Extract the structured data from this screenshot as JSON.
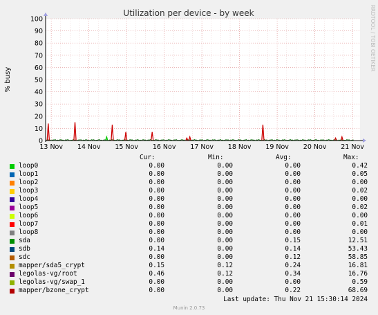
{
  "chart_data": {
    "type": "line",
    "title": "Utilization per device - by week",
    "ylabel": "% busy",
    "side_label": "RRDTOOL / TOBI OETIKER",
    "ylim": [
      0,
      100
    ],
    "yticks": [
      0,
      10,
      20,
      30,
      40,
      50,
      60,
      70,
      80,
      90,
      100
    ],
    "xlim_days": [
      12.85,
      21.2
    ],
    "x_ticks": [
      {
        "day": 13,
        "label": "13 Nov"
      },
      {
        "day": 14,
        "label": "14 Nov"
      },
      {
        "day": 15,
        "label": "15 Nov"
      },
      {
        "day": 16,
        "label": "16 Nov"
      },
      {
        "day": 17,
        "label": "17 Nov"
      },
      {
        "day": 18,
        "label": "18 Nov"
      },
      {
        "day": 19,
        "label": "19 Nov"
      },
      {
        "day": 20,
        "label": "20 Nov"
      },
      {
        "day": 21,
        "label": "21 Nov"
      }
    ],
    "spikes": [
      {
        "day": 12.92,
        "value": 14,
        "color": "#CC0000"
      },
      {
        "day": 13.63,
        "value": 15,
        "color": "#CC0000"
      },
      {
        "day": 14.47,
        "value": 3,
        "color": "#00CC00"
      },
      {
        "day": 14.62,
        "value": 13,
        "color": "#CC0000"
      },
      {
        "day": 14.98,
        "value": 7,
        "color": "#CC0000"
      },
      {
        "day": 15.68,
        "value": 7,
        "color": "#CC0000"
      },
      {
        "day": 16.6,
        "value": 2,
        "color": "#CC0000"
      },
      {
        "day": 16.68,
        "value": 3,
        "color": "#CC0000"
      },
      {
        "day": 18.62,
        "value": 13,
        "color": "#CC0000"
      },
      {
        "day": 20.55,
        "value": 2,
        "color": "#CC0000"
      },
      {
        "day": 20.72,
        "value": 3,
        "color": "#CC0000"
      }
    ],
    "legend_headers": {
      "cur": "Cur:",
      "min": "Min:",
      "avg": "Avg:",
      "max": "Max:"
    },
    "series": [
      {
        "name": "loop0",
        "color": "#00CC00",
        "cur": "0.00",
        "min": "0.00",
        "avg": "0.00",
        "max": "0.42"
      },
      {
        "name": "loop1",
        "color": "#0066B3",
        "cur": "0.00",
        "min": "0.00",
        "avg": "0.00",
        "max": "0.05"
      },
      {
        "name": "loop2",
        "color": "#FF8000",
        "cur": "0.00",
        "min": "0.00",
        "avg": "0.00",
        "max": "0.00"
      },
      {
        "name": "loop3",
        "color": "#FFCC00",
        "cur": "0.00",
        "min": "0.00",
        "avg": "0.00",
        "max": "0.02"
      },
      {
        "name": "loop4",
        "color": "#330099",
        "cur": "0.00",
        "min": "0.00",
        "avg": "0.00",
        "max": "0.00"
      },
      {
        "name": "loop5",
        "color": "#990099",
        "cur": "0.00",
        "min": "0.00",
        "avg": "0.00",
        "max": "0.02"
      },
      {
        "name": "loop6",
        "color": "#CCFF00",
        "cur": "0.00",
        "min": "0.00",
        "avg": "0.00",
        "max": "0.00"
      },
      {
        "name": "loop7",
        "color": "#FF0000",
        "cur": "0.00",
        "min": "0.00",
        "avg": "0.00",
        "max": "0.01"
      },
      {
        "name": "loop8",
        "color": "#808080",
        "cur": "0.00",
        "min": "0.00",
        "avg": "0.00",
        "max": "0.00"
      },
      {
        "name": "sda",
        "color": "#008F00",
        "cur": "0.00",
        "min": "0.00",
        "avg": "0.15",
        "max": "12.51"
      },
      {
        "name": "sdb",
        "color": "#00487D",
        "cur": "0.14",
        "min": "0.00",
        "avg": "0.14",
        "max": "53.43"
      },
      {
        "name": "sdc",
        "color": "#B35A00",
        "cur": "0.00",
        "min": "0.00",
        "avg": "0.12",
        "max": "58.85"
      },
      {
        "name": "mapper/sda5_crypt",
        "color": "#B38F00",
        "cur": "0.15",
        "min": "0.12",
        "avg": "0.24",
        "max": "16.81"
      },
      {
        "name": "legolas-vg/root",
        "color": "#6B006B",
        "cur": "0.46",
        "min": "0.12",
        "avg": "0.34",
        "max": "16.76"
      },
      {
        "name": "legolas-vg/swap_1",
        "color": "#8FB300",
        "cur": "0.00",
        "min": "0.00",
        "avg": "0.00",
        "max": "0.59"
      },
      {
        "name": "mapper/bzone_crypt",
        "color": "#B30000",
        "cur": "0.00",
        "min": "0.00",
        "avg": "0.22",
        "max": "68.69"
      }
    ]
  },
  "footer": {
    "last_update": "Last update: Thu Nov 21 15:30:14 2024",
    "version": "Munin 2.0.73"
  }
}
